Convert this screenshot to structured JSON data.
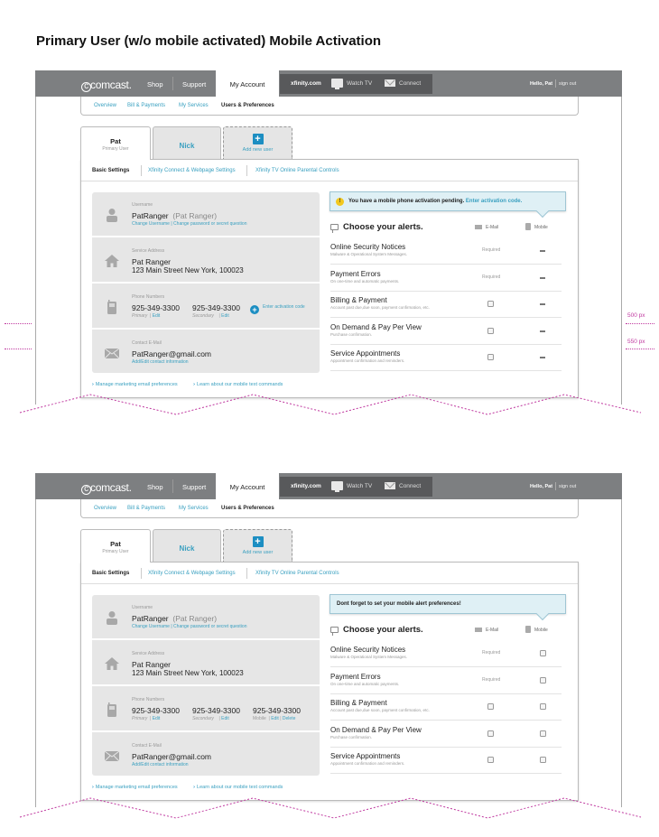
{
  "page_title": "Primary User (w/o mobile activated) Mobile Activation",
  "brand": {
    "logo_text": "comcast.",
    "accent": "#3aa0c0",
    "link_blue": "#1c8ec2",
    "annotation_color": "#c03aa0"
  },
  "top_nav": {
    "shop": "Shop",
    "support": "Support",
    "my_account": "My Account",
    "xfinity": "xfinity.com",
    "watch_tv": "Watch TV",
    "connect": "Connect",
    "hello": "Hello, Pat",
    "sign_out": "sign out"
  },
  "sub_nav": [
    "Overview",
    "Bill & Payments",
    "My Services",
    "Users & Preferences"
  ],
  "user_tabs": {
    "pat": {
      "name": "Pat",
      "role": "Primary User"
    },
    "nick": {
      "name": "Nick"
    },
    "add": {
      "icon": "plus-icon",
      "label": "Add new user"
    }
  },
  "settings_tabs": [
    "Basic Settings",
    "Xfinity Connect & Webpage Settings",
    "Xfinity TV Online Parental Controls"
  ],
  "info": {
    "username_label": "Username",
    "username": "PatRanger",
    "username_display": "(Pat Ranger)",
    "change_username": "Change Username",
    "change_password": "Change password or secret question",
    "address_label": "Service Address",
    "address_name": "Pat Ranger",
    "address_line": "123 Main Street New York, 100023",
    "phone_label": "Phone Numbers",
    "phone_primary": "925-349-3300",
    "primary_label": "Primary",
    "phone_secondary": "925-349-3300",
    "secondary_label": "Secondary",
    "phone_mobile": "925-349-3300",
    "mobile_label": "Mobile",
    "edit": "Edit",
    "delete": "Delete",
    "enter_activation": "Enter activation code",
    "email_label": "Contact E-Mail",
    "email": "PatRanger@gmail.com",
    "email_link": "Add/Edit contact information"
  },
  "footer_links": [
    "Manage marketing email preferences",
    "Learn about our mobile text commands"
  ],
  "notices": {
    "pending_text": "You have a mobile phone activation pending.",
    "pending_link": "Enter activation code.",
    "reminder": "Dont forget to set your mobile alert preferences!"
  },
  "alerts": {
    "title": "Choose your alerts.",
    "email_col": "E-Mail",
    "mobile_col": "Mobile",
    "required": "Required",
    "rows": [
      {
        "name": "Online Security Notices",
        "desc": "Malware & Operational System Messages.",
        "email_required": true
      },
      {
        "name": "Payment Errors",
        "desc": "On one-time and automatic payments.",
        "email_required": true
      },
      {
        "name": "Billing & Payment",
        "desc": "Account past due,due soon, payment confirmation, etc.",
        "email_required": false
      },
      {
        "name": "On Demand & Pay Per View",
        "desc": "Purchase confirmation.",
        "email_required": false
      },
      {
        "name": "Service Appointments",
        "desc": "Appointment confirmation and reminders.",
        "email_required": false
      }
    ]
  },
  "annotations": {
    "fold_500": "500 px",
    "fold_550": "550 px"
  }
}
